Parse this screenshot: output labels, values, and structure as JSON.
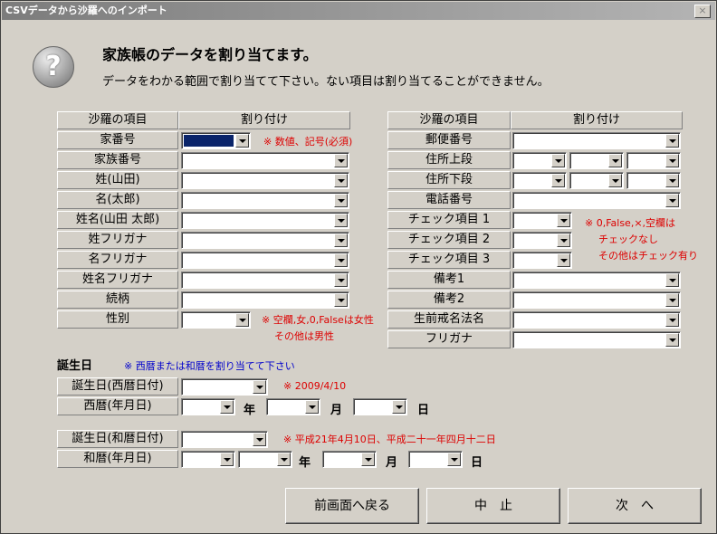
{
  "window": {
    "title": "CSVデータから沙羅へのインポート",
    "close_label": "×"
  },
  "header": {
    "title": "家族帳のデータを割り当てます。",
    "subtitle": "データをわかる範囲で割り当てて下さい。ない項目は割り当てることができません。",
    "icon": "question-icon",
    "icon_glyph": "?"
  },
  "columns": {
    "item": "沙羅の項目",
    "assign": "割り付け"
  },
  "left_fields": [
    "家番号",
    "家族番号",
    "姓(山田)",
    "名(太郎)",
    "姓名(山田 太郎)",
    "姓フリガナ",
    "名フリガナ",
    "姓名フリガナ",
    "続柄",
    "性別"
  ],
  "right_fields": [
    "郵便番号",
    "住所上段",
    "住所下段",
    "電話番号",
    "チェック項目 1",
    "チェック項目 2",
    "チェック項目 3",
    "備考1",
    "備考2",
    "生前戒名法名",
    "フリガナ"
  ],
  "notes": {
    "house_no": "※ 数値、記号(必須)",
    "gender_1": "※ 空欄,女,0,Falseは女性",
    "gender_2": "その他は男性",
    "check_1": "※ 0,False,×,空欄は",
    "check_2": "チェックなし",
    "check_3": "その他はチェック有り"
  },
  "birthday": {
    "section": "誕生日",
    "hint": "※ 西暦または和暦を割り当てて下さい",
    "western_date": "誕生日(西暦日付)",
    "western_example": "※ 2009/4/10",
    "western_ymd": "西暦(年月日)",
    "japanese_date": "誕生日(和暦日付)",
    "japanese_example": "※ 平成21年4月10日、平成二十一年四月十二日",
    "japanese_ymd": "和暦(年月日)",
    "year": "年",
    "month": "月",
    "day": "日"
  },
  "buttons": {
    "back": "前画面へ戻る",
    "cancel": "中　止",
    "next": "次　へ"
  },
  "colors": {
    "window_bg": "#d4d0c8",
    "note_red": "#dd0000",
    "hint_blue": "#0000cc",
    "selected": "#0a246a"
  }
}
